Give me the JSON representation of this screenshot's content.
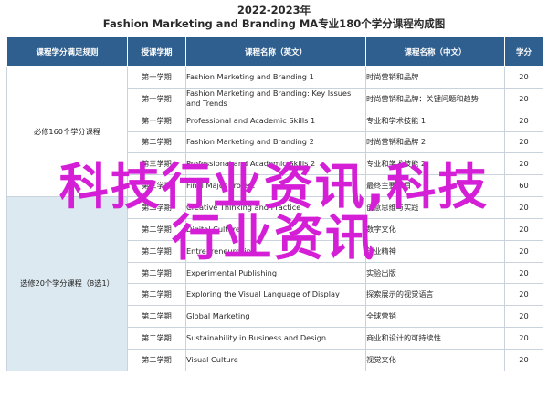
{
  "title": {
    "year": "2022-2023年",
    "main": "Fashion Marketing and Branding MA专业180个学分课程构成图"
  },
  "table": {
    "headers": [
      "课程学分满足规则",
      "授课学期",
      "课程名称（英文）",
      "课程名称（中文）",
      "学分"
    ],
    "groups": [
      {
        "label": "必修160个学分课程",
        "rows": [
          {
            "term": "第一学期",
            "en": "Fashion Marketing and Branding 1",
            "cn": "时尚营销和品牌",
            "credit": "20"
          },
          {
            "term": "第一学期",
            "en": "Fashion Marketing and Branding: Key Issues and Trends",
            "cn": "时尚营销和品牌：关键问题和趋势",
            "credit": "20"
          },
          {
            "term": "第一学期",
            "en": "Professional and Academic Skills 1",
            "cn": "专业和学术技能 1",
            "credit": "20"
          },
          {
            "term": "第二学期",
            "en": "Fashion Marketing and Branding 2",
            "cn": "时尚营销和品牌 2",
            "credit": "20"
          },
          {
            "term": "第三学期",
            "en": "Professional and Academic Skills 2",
            "cn": "专业和学术技能 2",
            "credit": "20"
          },
          {
            "term": "第三学期",
            "en": "Final Major Project",
            "cn": "最终主要项目",
            "credit": "60"
          }
        ]
      },
      {
        "label": "选修20个学分课程（8选1）",
        "rows": [
          {
            "term": "第二学期",
            "en": "Creative Thinking and Practice",
            "cn": "创意思维与实践",
            "credit": "20"
          },
          {
            "term": "第二学期",
            "en": "Digital Culture",
            "cn": "数字文化",
            "credit": "20"
          },
          {
            "term": "第二学期",
            "en": "Entrepreneurship",
            "cn": "创业精神",
            "credit": "20"
          },
          {
            "term": "第二学期",
            "en": "Experimental Publishing",
            "cn": "实验出版",
            "credit": "20"
          },
          {
            "term": "第二学期",
            "en": "Exploring the Visual Language of Display",
            "cn": "探索展示的视觉语言",
            "credit": "20"
          },
          {
            "term": "第二学期",
            "en": "Global Marketing",
            "cn": "全球营销",
            "credit": "20"
          },
          {
            "term": "第二学期",
            "en": "Sustainability in Business and Design",
            "cn": "商业和设计的可持续性",
            "credit": "20"
          },
          {
            "term": "第二学期",
            "en": "Visual Culture",
            "cn": "视觉文化",
            "credit": "20"
          }
        ]
      }
    ]
  },
  "watermark": {
    "line1": "科技行业资讯,科技",
    "line2": "行业资讯",
    "color": "#d51fd7"
  },
  "colors": {
    "header_bg": "#2f5f8f",
    "elective_bg": "#dce9f0"
  }
}
